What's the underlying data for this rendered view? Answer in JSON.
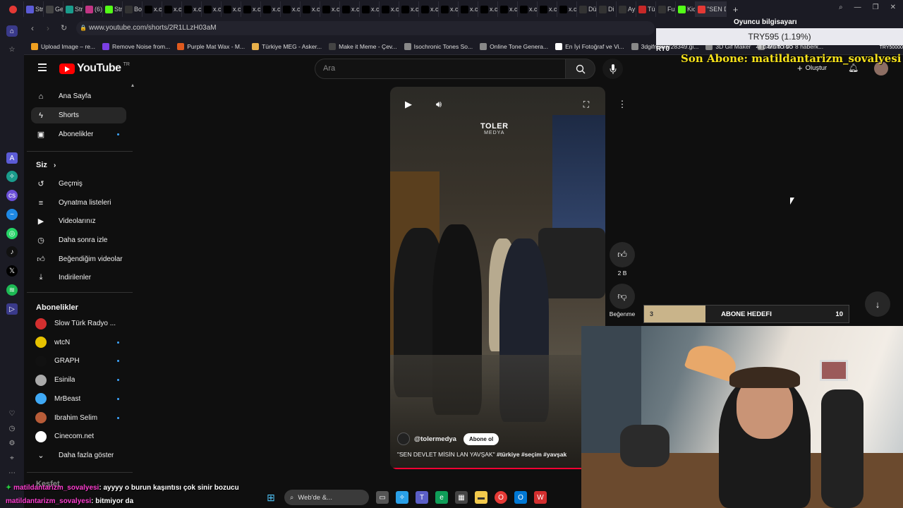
{
  "browser": {
    "tabs": [
      {
        "label": "Str",
        "color": "#5b5bd6"
      },
      {
        "label": "Ge",
        "color": "#444"
      },
      {
        "label": "Str",
        "color": "#1a9c8c"
      },
      {
        "label": "(6)",
        "color": "#c13584"
      },
      {
        "label": "Str",
        "color": "#53fc18"
      },
      {
        "label": "Bo",
        "color": "#333"
      },
      {
        "label": "x.c",
        "color": "#000"
      },
      {
        "label": "x.c",
        "color": "#000"
      },
      {
        "label": "x.c",
        "color": "#000"
      },
      {
        "label": "x.c",
        "color": "#000"
      },
      {
        "label": "x.c",
        "color": "#000"
      },
      {
        "label": "x.c",
        "color": "#000"
      },
      {
        "label": "x.c",
        "color": "#000"
      },
      {
        "label": "x.c",
        "color": "#000"
      },
      {
        "label": "x.c",
        "color": "#000"
      },
      {
        "label": "x.c",
        "color": "#000"
      },
      {
        "label": "x.c",
        "color": "#000"
      },
      {
        "label": "x.c",
        "color": "#000"
      },
      {
        "label": "x.c",
        "color": "#000"
      },
      {
        "label": "x.c",
        "color": "#000"
      },
      {
        "label": "x.c",
        "color": "#000"
      },
      {
        "label": "x.c",
        "color": "#000"
      },
      {
        "label": "x.c",
        "color": "#000"
      },
      {
        "label": "x.c",
        "color": "#000"
      },
      {
        "label": "x.c",
        "color": "#000"
      },
      {
        "label": "x.c",
        "color": "#000"
      },
      {
        "label": "x.c",
        "color": "#000"
      },
      {
        "label": "x.c",
        "color": "#000"
      },
      {
        "label": "Dü",
        "color": "#333"
      },
      {
        "label": "Di",
        "color": "#333"
      },
      {
        "label": "Ay",
        "color": "#333"
      },
      {
        "label": "Tü",
        "color": "#c62828"
      },
      {
        "label": "Fu",
        "color": "#333"
      },
      {
        "label": "Kic",
        "color": "#53fc18"
      }
    ],
    "active_tab_label": "\"SEN D",
    "url": "www.youtube.com/shorts/2R1LLzH03aM",
    "bookmarks": [
      {
        "label": "Upload Image – re...",
        "color": "#f0a020"
      },
      {
        "label": "Remove Noise from...",
        "color": "#7b3fe4"
      },
      {
        "label": "Purple Mat Wax - M...",
        "color": "#e05a1e"
      },
      {
        "label": "Türkiye MEG - Asker...",
        "color": "#e8b04a"
      },
      {
        "label": "Make it Meme - Çev...",
        "color": "#444"
      },
      {
        "label": "Isochronic Tones So...",
        "color": "#888"
      },
      {
        "label": "Online Tone Genera...",
        "color": "#888"
      },
      {
        "label": "En İyi Fotoğraf ve Vi...",
        "color": "#fff"
      },
      {
        "label": "3dgifmaker28349.gi...",
        "color": "#888"
      },
      {
        "label": "3D Gif Maker",
        "color": "#888"
      },
      {
        "label": "Multi TV - 8 haberk...",
        "color": "#888"
      }
    ]
  },
  "youtube": {
    "logo_text": "YouTube",
    "region": "TR",
    "search_placeholder": "Ara",
    "create_label": "Oluştur",
    "nav": {
      "main": [
        {
          "label": "Ana Sayfa",
          "icon": "home-icon"
        },
        {
          "label": "Shorts",
          "icon": "shorts-icon"
        },
        {
          "label": "Abonelikler",
          "icon": "subscriptions-icon"
        }
      ],
      "you_header": "Siz",
      "you": [
        {
          "label": "Geçmiş",
          "icon": "history-icon"
        },
        {
          "label": "Oynatma listeleri",
          "icon": "playlist-icon"
        },
        {
          "label": "Videolarınız",
          "icon": "your-videos-icon"
        },
        {
          "label": "Daha sonra izle",
          "icon": "watch-later-icon"
        },
        {
          "label": "Beğendiğim videolar",
          "icon": "liked-icon"
        },
        {
          "label": "İndirilenler",
          "icon": "download-icon"
        }
      ],
      "subs_header": "Abonelikler",
      "subs": [
        {
          "label": "Slow Türk Radyo ...",
          "color": "#d32f2f"
        },
        {
          "label": "wtcN",
          "color": "#e6c200"
        },
        {
          "label": "GRAPH",
          "color": "#111"
        },
        {
          "label": "Esinila",
          "color": "#aaa"
        },
        {
          "label": "MrBeast",
          "color": "#3fa9f5"
        },
        {
          "label": "İbrahim Selim",
          "color": "#b85c38"
        },
        {
          "label": "Cinecom.net",
          "color": "#fff"
        }
      ],
      "more_label": "Daha fazla göster",
      "explore_label": "Keşfet"
    },
    "short": {
      "watermark_1": "TOLER",
      "watermark_2": "MEDYA",
      "channel": "@tolermedya",
      "subscribe_label": "Abone ol",
      "caption_text": "\"SEN DEVLET MİSİN LAN YAVŞAK\" ",
      "caption_tags": "#türkiye #seçim #yavşak",
      "likes": "2 B",
      "dislike_label": "Beğenme"
    }
  },
  "stream_overlay": {
    "ticker_title": "Oyuncu bilgisayarı",
    "ticker_value": "TRY595 (1.19%)",
    "ticker_left": "RY0",
    "ticker_mid": "48 DAYS TO GO",
    "ticker_right": "TRY50000",
    "last_sub_label": "Son Abone: matildantarizm_sovalyesi",
    "goal_start": "3",
    "goal_label": "ABONE HEDEFI",
    "goal_end": "10",
    "goal_fraction": 0.3
  },
  "chat": [
    {
      "user": "matildantarizm_sovalyesi",
      "msg": ": ayyyy o burun kaşıntısı çok sinir bozucu"
    },
    {
      "user": "matildantarizm_sovalyesi",
      "msg": ": bitmiyor da"
    }
  ],
  "taskbar": {
    "search_label": "Web'de &..."
  }
}
